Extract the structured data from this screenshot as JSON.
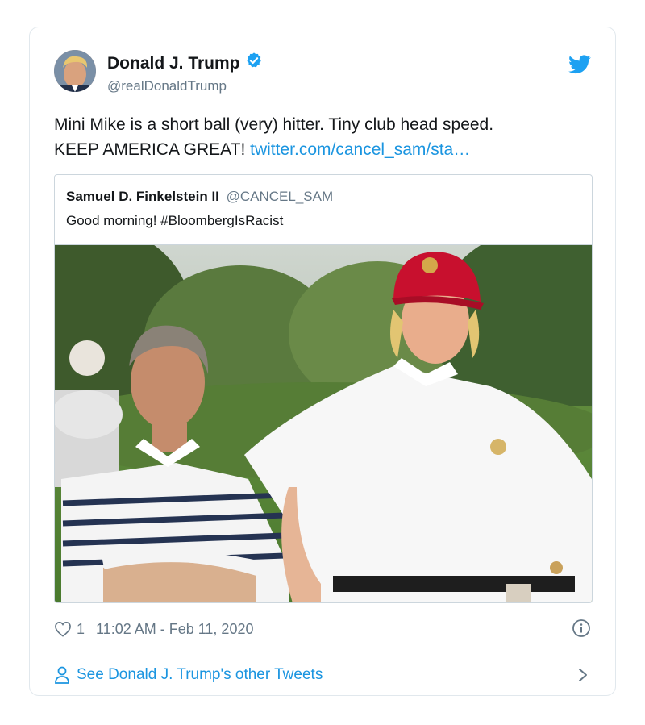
{
  "author": {
    "display_name": "Donald J. Trump",
    "handle": "@realDonaldTrump"
  },
  "tweet": {
    "text_line1": "Mini Mike is a short ball (very) hitter. Tiny club head speed.",
    "text_line2": "KEEP AMERICA GREAT!",
    "link": "twitter.com/cancel_sam/sta…"
  },
  "quoted": {
    "author_name": "Samuel D. Finkelstein II",
    "author_handle": "@CANCEL_SAM",
    "text": "Good morning! #BloombergIsRacist"
  },
  "meta": {
    "likes": "1",
    "timestamp": "11:02 AM - Feb 11, 2020"
  },
  "footer": {
    "label": "See Donald J. Trump's other Tweets"
  },
  "icons": {
    "verified": "verified-badge-icon",
    "bird": "twitter-bird-icon",
    "heart": "heart-icon",
    "info": "info-icon",
    "person": "person-icon",
    "chevron": "chevron-right-icon"
  },
  "colors": {
    "link": "#1b95e0",
    "secondary_text": "#657786",
    "border": "#e1e8ed"
  }
}
